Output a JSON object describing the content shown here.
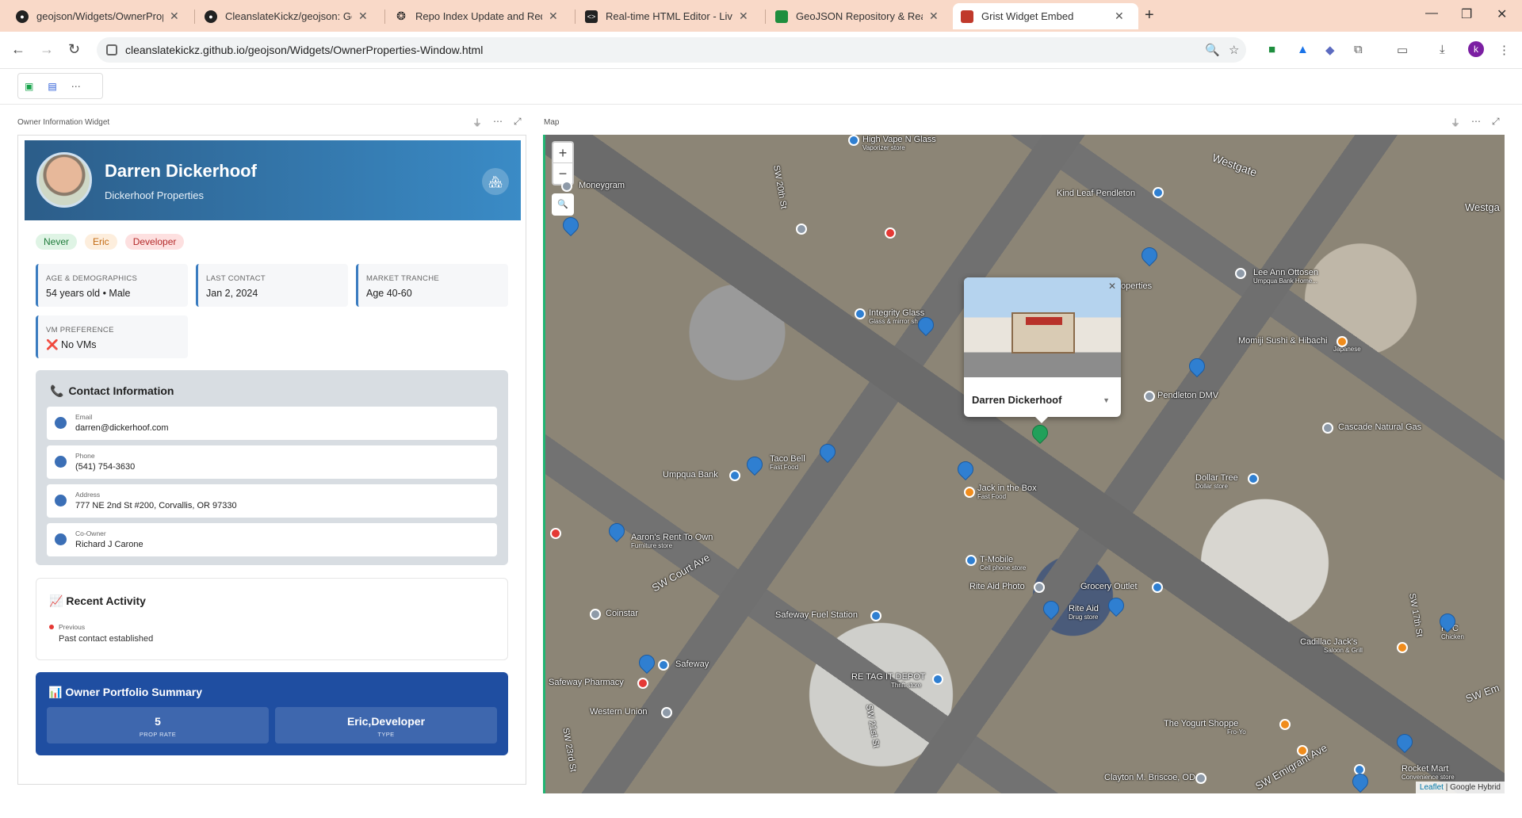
{
  "browser": {
    "tabs": [
      {
        "title": "geojson/Widgets/OwnerProper",
        "active": false
      },
      {
        "title": "CleanslateKickz/geojson: GeoJS",
        "active": false
      },
      {
        "title": "Repo Index Update and Redesic",
        "active": false
      },
      {
        "title": "Real-time HTML Editor - Live H",
        "active": false
      },
      {
        "title": "GeoJSON Repository & Real Est",
        "active": false
      },
      {
        "title": "Grist Widget Embed",
        "active": true
      }
    ],
    "url": "cleanslatekickz.github.io/geojson/Widgets/OwnerProperties-Window.html",
    "profile_initial": "k"
  },
  "sections": {
    "owner_title": "Owner Information Widget",
    "map_title": "Map"
  },
  "owner": {
    "name": "Darren Dickerhoof",
    "company": "Dickerhoof Properties",
    "tags": [
      "Never",
      "Eric",
      "Developer"
    ],
    "cards": [
      {
        "label": "AGE & DEMOGRAPHICS",
        "value": "54 years old • Male"
      },
      {
        "label": "LAST CONTACT",
        "value": "Jan 2, 2024"
      },
      {
        "label": "MARKET TRANCHE",
        "value": "Age 40-60"
      },
      {
        "label": "VM PREFERENCE",
        "value": "❌ No VMs"
      }
    ],
    "contact": {
      "title": "Contact Information",
      "rows": [
        {
          "label": "Email",
          "value": "darren@dickerhoof.com"
        },
        {
          "label": "Phone",
          "value": "(541) 754-3630"
        },
        {
          "label": "Address",
          "value": "777 NE 2nd St #200, Corvallis, OR 97330"
        },
        {
          "label": "Co-Owner",
          "value": "Richard J Carone"
        }
      ]
    },
    "activity": {
      "title": "Recent Activity",
      "label": "Previous",
      "value": "Past contact established"
    },
    "summary": {
      "title": "Owner Portfolio Summary",
      "boxes": [
        {
          "value": "5",
          "label": "PROP RATE"
        },
        {
          "value": "Eric,Developer",
          "label": "TYPE"
        }
      ]
    }
  },
  "map": {
    "zoom_in": "+",
    "zoom_out": "−",
    "popup_name": "Darren Dickerhoof",
    "attribution_link": "Leaflet",
    "attribution_rest": " | Google Hybrid",
    "labels": [
      {
        "text": "Moneygram",
        "sub": ""
      },
      {
        "text": "High Vape N Glass",
        "sub": "Vaporizer store"
      },
      {
        "text": "Westgate",
        "sub": ""
      },
      {
        "text": "Kind Leaf Pendleton",
        "sub": ""
      },
      {
        "text": "Lee Ann Ottosen",
        "sub": "Umpqua Bank Home..."
      },
      {
        "text": "Integrity Glass",
        "sub": "Glass & mirror sh..."
      },
      {
        "text": "Momiji Sushi & Hibachi",
        "sub": "Japanese"
      },
      {
        "text": "Pendleton DMV",
        "sub": ""
      },
      {
        "text": "Cascade Natural Gas",
        "sub": ""
      },
      {
        "text": "Taco Bell",
        "sub": "Fast Food"
      },
      {
        "text": "Umpqua Bank",
        "sub": ""
      },
      {
        "text": "Jack in the Box",
        "sub": "Fast Food"
      },
      {
        "text": "Dollar Tree",
        "sub": "Dollar store"
      },
      {
        "text": "Aaron's Rent To Own",
        "sub": "Furniture store"
      },
      {
        "text": "T-Mobile",
        "sub": "Cell phone store"
      },
      {
        "text": "Rite Aid Photo",
        "sub": ""
      },
      {
        "text": "Grocery Outlet",
        "sub": ""
      },
      {
        "text": "Rite Aid",
        "sub": "Drug store"
      },
      {
        "text": "Coinstar",
        "sub": ""
      },
      {
        "text": "Safeway Fuel Station",
        "sub": ""
      },
      {
        "text": "Safeway",
        "sub": ""
      },
      {
        "text": "Safeway Pharmacy",
        "sub": ""
      },
      {
        "text": "RE TAG IT DEPOT",
        "sub": "Thrift store"
      },
      {
        "text": "Western Union",
        "sub": ""
      },
      {
        "text": "The Yogurt Shoppe",
        "sub": "Fro-Yo"
      },
      {
        "text": "Cadillac Jack's",
        "sub": "Saloon & Grill"
      },
      {
        "text": "KFC",
        "sub": "Chicken"
      },
      {
        "text": "Rocket Mart",
        "sub": "Convenience store"
      },
      {
        "text": "Clayton M. Briscoe, OD",
        "sub": ""
      },
      {
        "text": "SW 20th St",
        "sub": ""
      },
      {
        "text": "SW Court Ave",
        "sub": ""
      },
      {
        "text": "SW 23rd St",
        "sub": ""
      },
      {
        "text": "SW 21st St",
        "sub": ""
      },
      {
        "text": "SW 17th St",
        "sub": ""
      },
      {
        "text": "SW Emigrant Ave",
        "sub": ""
      },
      {
        "text": "SW Em",
        "sub": ""
      },
      {
        "text": "Westga",
        "sub": ""
      },
      {
        "text": "operties",
        "sub": ""
      }
    ]
  }
}
